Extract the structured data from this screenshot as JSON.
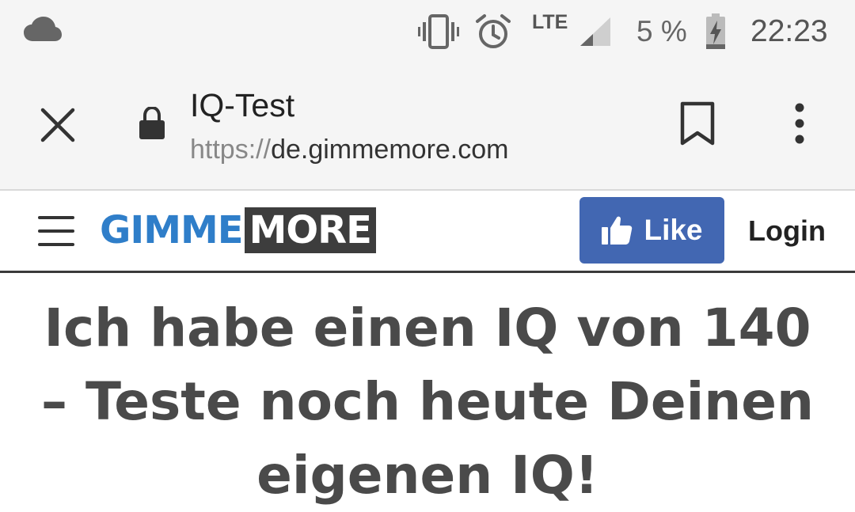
{
  "status_bar": {
    "time": "22:23",
    "battery_percent": "5 %",
    "network": "LTE",
    "icons": [
      "cloud-icon",
      "vibrate-icon",
      "alarm-icon",
      "signal-icon",
      "battery-charging-icon"
    ]
  },
  "browser": {
    "page_title": "IQ-Test",
    "url_scheme": "https://",
    "url_host": "de.gimmemore.com",
    "icons": [
      "close-icon",
      "lock-icon",
      "bookmark-icon",
      "more-vert-icon"
    ]
  },
  "site_header": {
    "logo_part1": "GIMME",
    "logo_part2": "MORE",
    "like_label": "Like",
    "login_label": "Login",
    "colors": {
      "logo_blue": "#2f7ec9",
      "facebook_blue": "#4267b2"
    }
  },
  "article": {
    "headline": "Ich habe einen IQ von 140 – Teste noch heute Deinen eigenen IQ!"
  }
}
